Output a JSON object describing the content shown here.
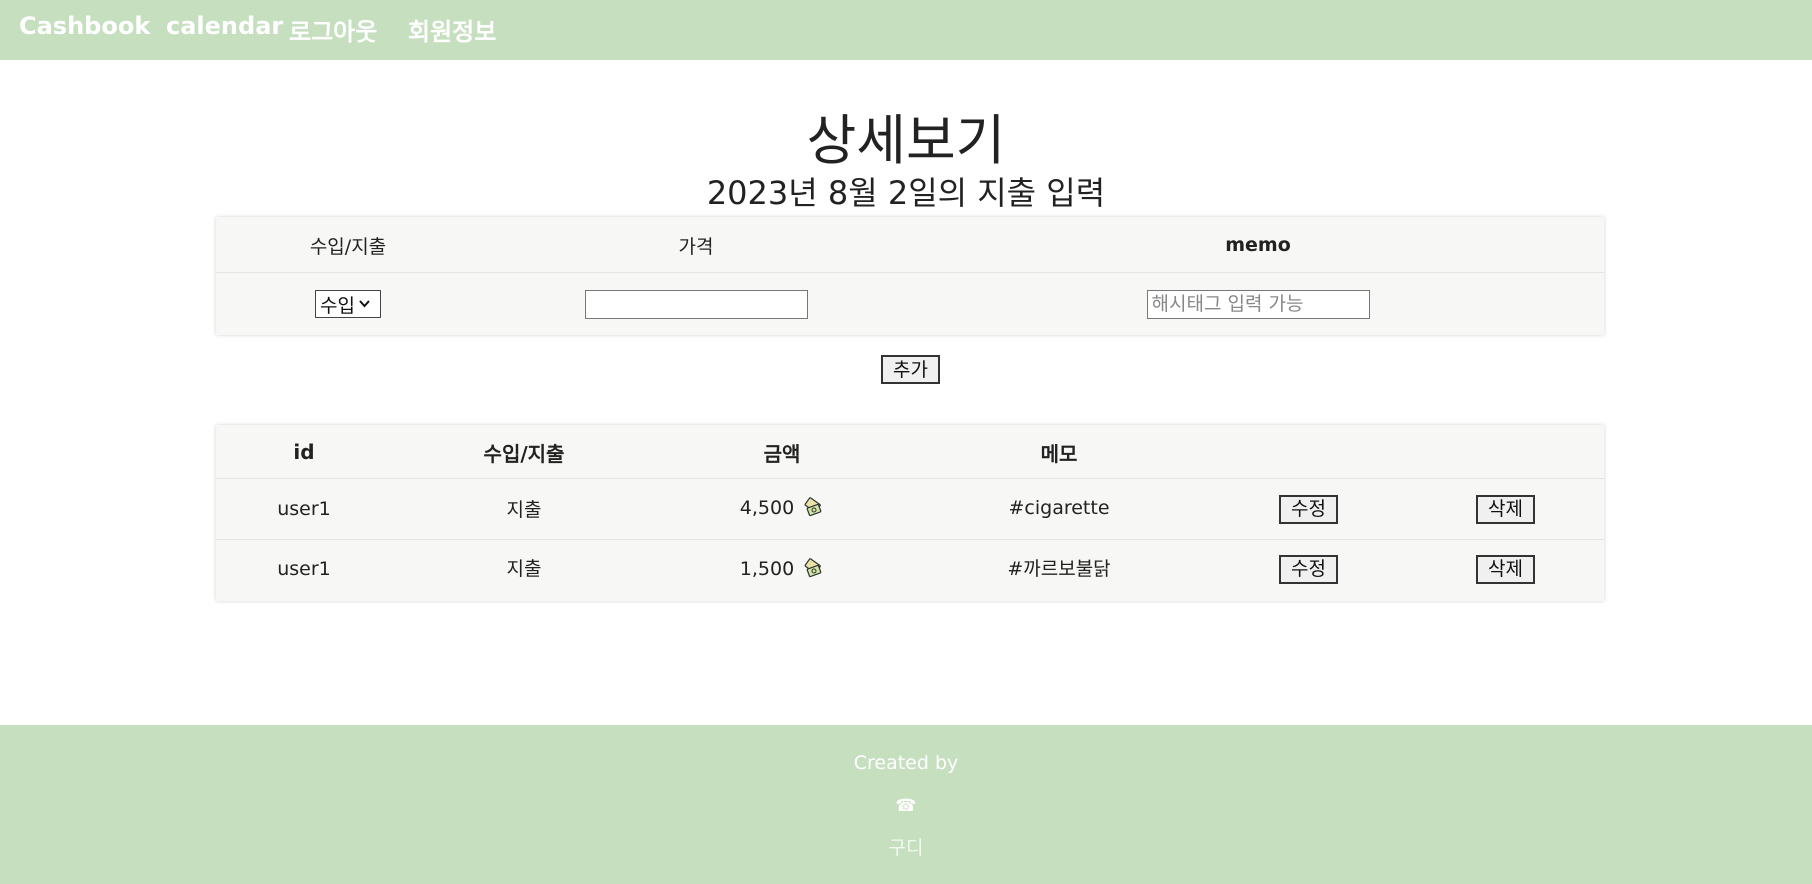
{
  "nav": {
    "brand": "Cashbook",
    "calendar": "calendar",
    "logout": "로그아웃",
    "member_info": "회원정보"
  },
  "page": {
    "title": "상세보기",
    "subtitle": "2023년 8월 2일의 지출 입력"
  },
  "form": {
    "headers": [
      "수입/지출",
      "가격",
      "memo"
    ],
    "type_select_value": "수입",
    "price_value": "",
    "memo_placeholder": "해시태그 입력 가능",
    "add_label": "추가"
  },
  "table": {
    "columns": [
      "id",
      "수입/지출",
      "금액",
      "메모"
    ],
    "rows": [
      {
        "id": "user1",
        "type": "지출",
        "amount": "4,500",
        "memo": "#cigarette",
        "edit": "수정",
        "delete": "삭제"
      },
      {
        "id": "user1",
        "type": "지출",
        "amount": "1,500",
        "memo": "#까르보불닭",
        "edit": "수정",
        "delete": "삭제"
      }
    ]
  },
  "footer": {
    "created_by": "Created by",
    "phone_icon": "☎",
    "author": "구디"
  },
  "colors": {
    "nav_bg": "#c5dfbf",
    "footer_bg": "#c5dfbf",
    "panel_bg": "#f7f8f5"
  },
  "icons": {
    "amount_icon": "money-icon",
    "phone": "phone-icon"
  }
}
